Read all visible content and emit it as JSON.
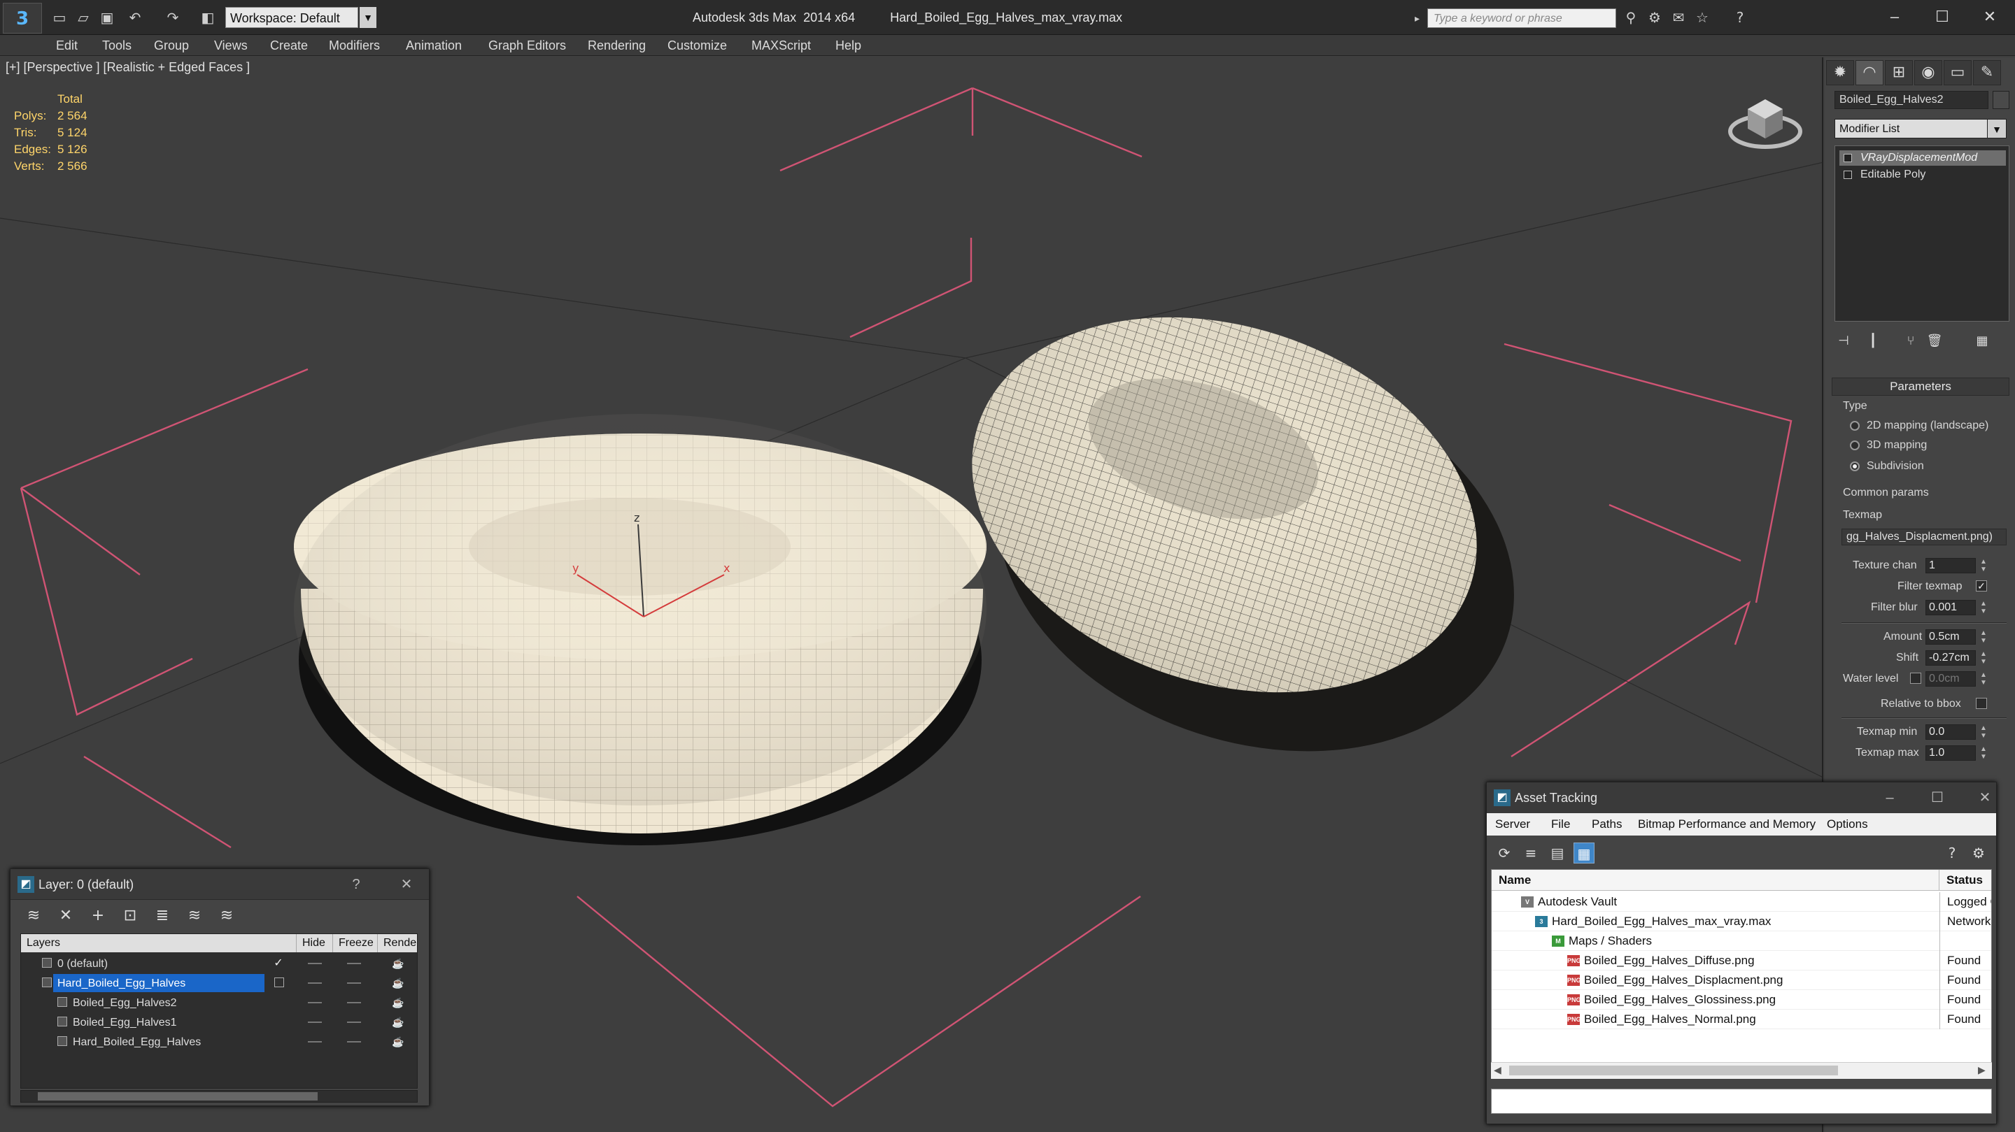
{
  "titlebar": {
    "app_title": "Autodesk 3ds Max  2014 x64",
    "file_name": "Hard_Boiled_Egg_Halves_max_vray.max",
    "workspace": "Workspace: Default",
    "search_placeholder": "Type a keyword or phrase"
  },
  "menu": [
    "Edit",
    "Tools",
    "Group",
    "Views",
    "Create",
    "Modifiers",
    "Animation",
    "Graph Editors",
    "Rendering",
    "Customize",
    "MAXScript",
    "Help"
  ],
  "viewport": {
    "label": "[+] [Perspective ] [Realistic + Edged Faces ]",
    "stats_header": "Total",
    "stats": [
      {
        "label": "Polys:",
        "value": "2 564"
      },
      {
        "label": "Tris:",
        "value": "5 124"
      },
      {
        "label": "Edges:",
        "value": "5 126"
      },
      {
        "label": "Verts:",
        "value": "2 566"
      }
    ],
    "gizmo_axes": {
      "x": "x",
      "y": "y",
      "z": "z"
    }
  },
  "command_panel": {
    "object_name": "Boiled_Egg_Halves2",
    "modifier_list": "Modifier List",
    "stack": [
      "VRayDisplacementMod",
      "Editable Poly"
    ],
    "params_title": "Parameters",
    "type_label": "Type",
    "type_options": [
      "2D mapping (landscape)",
      "3D mapping",
      "Subdivision"
    ],
    "type_selected": 2,
    "common_params": "Common params",
    "texmap_label": "Texmap",
    "texmap_value": "gg_Halves_Displacment.png)",
    "texture_chan_label": "Texture chan",
    "texture_chan": "1",
    "filter_texmap_label": "Filter texmap",
    "filter_blur_label": "Filter blur",
    "filter_blur": "0.001",
    "amount_label": "Amount",
    "amount": "0.5cm",
    "shift_label": "Shift",
    "shift": "-0.27cm",
    "water_level_label": "Water level",
    "water_level": "0.0cm",
    "relative_bbox_label": "Relative to bbox",
    "texmap_min_label": "Texmap min",
    "texmap_min": "0.0",
    "texmap_max_label": "Texmap max",
    "texmap_max": "1.0"
  },
  "layer_dialog": {
    "title": "Layer: 0 (default)",
    "columns": [
      "Layers",
      "Hide",
      "Freeze",
      "Rende"
    ],
    "rows": [
      {
        "name": "0 (default)",
        "indent": 0
      },
      {
        "name": "Hard_Boiled_Egg_Halves",
        "indent": 0
      },
      {
        "name": "Boiled_Egg_Halves2",
        "indent": 1
      },
      {
        "name": "Boiled_Egg_Halves1",
        "indent": 1
      },
      {
        "name": "Hard_Boiled_Egg_Halves",
        "indent": 1
      }
    ]
  },
  "asset_tracking": {
    "title": "Asset Tracking",
    "menu": [
      "Server",
      "File",
      "Paths",
      "Bitmap Performance and Memory",
      "Options"
    ],
    "columns": [
      "Name",
      "Status"
    ],
    "rows": [
      {
        "name": "Autodesk Vault",
        "status": "Logged O"
      },
      {
        "name": "Hard_Boiled_Egg_Halves_max_vray.max",
        "status": "Network"
      },
      {
        "name": "Maps / Shaders",
        "status": ""
      },
      {
        "name": "Boiled_Egg_Halves_Diffuse.png",
        "status": "Found"
      },
      {
        "name": "Boiled_Egg_Halves_Displacment.png",
        "status": "Found"
      },
      {
        "name": "Boiled_Egg_Halves_Glossiness.png",
        "status": "Found"
      },
      {
        "name": "Boiled_Egg_Halves_Normal.png",
        "status": "Found"
      }
    ]
  },
  "colors": {
    "accent": "#1a66c8",
    "stats_text": "#ffd56a",
    "grid_lines": "#e0577a",
    "egg_surface": "#efe6d2"
  }
}
